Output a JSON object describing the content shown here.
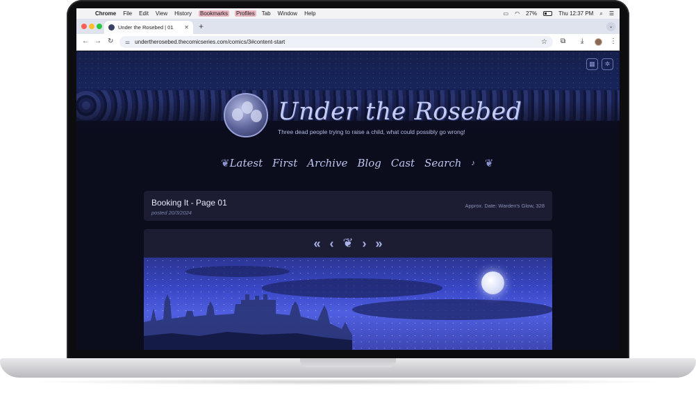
{
  "menubar": {
    "app": "Chrome",
    "items": [
      "File",
      "Edit",
      "View",
      "History",
      "Bookmarks",
      "Profiles",
      "Tab",
      "Window",
      "Help"
    ],
    "battery": "27%",
    "clock": "Thu 12:37 PM"
  },
  "browser": {
    "tab_title": "Under the Rosebed | 01",
    "url": "undertherosebed.thecomicseries.com/comics/3#content-start"
  },
  "site": {
    "title": "Under the Rosebed",
    "tagline": "Three dead people trying to raise a child, what could possibly go wrong!",
    "nav": [
      "Latest",
      "First",
      "Archive",
      "Blog",
      "Cast",
      "Search"
    ]
  },
  "post": {
    "title": "Booking It - Page 01",
    "posted": "posted 20/3/2024",
    "approx_date": "Approx. Date: Warden's Glow, 328"
  },
  "icons": {
    "apple": "apple-icon",
    "wifi": "wifi-icon",
    "battery": "battery-icon",
    "search": "search-icon",
    "control_center": "control-center-icon",
    "calendar": "calendar-icon",
    "settings": "gear-icon",
    "bell": "bell-icon",
    "rose": "rose-icon"
  },
  "colors": {
    "page_bg": "#0b0c1c",
    "panel_bg": "#1c1d33",
    "title_text": "#c5ccf3",
    "accent": "#aab3ea"
  }
}
